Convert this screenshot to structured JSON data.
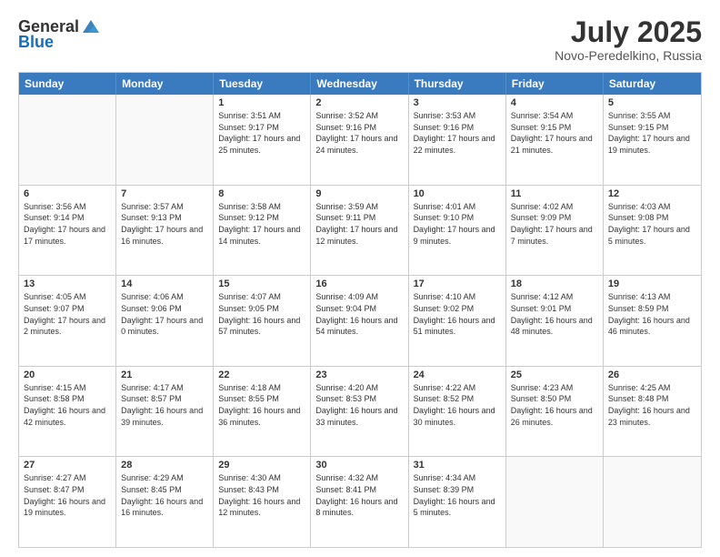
{
  "header": {
    "logo_general": "General",
    "logo_blue": "Blue",
    "month_year": "July 2025",
    "location": "Novo-Peredelkino, Russia"
  },
  "days_of_week": [
    "Sunday",
    "Monday",
    "Tuesday",
    "Wednesday",
    "Thursday",
    "Friday",
    "Saturday"
  ],
  "weeks": [
    [
      {
        "day": "",
        "info": ""
      },
      {
        "day": "",
        "info": ""
      },
      {
        "day": "1",
        "info": "Sunrise: 3:51 AM\nSunset: 9:17 PM\nDaylight: 17 hours and 25 minutes."
      },
      {
        "day": "2",
        "info": "Sunrise: 3:52 AM\nSunset: 9:16 PM\nDaylight: 17 hours and 24 minutes."
      },
      {
        "day": "3",
        "info": "Sunrise: 3:53 AM\nSunset: 9:16 PM\nDaylight: 17 hours and 22 minutes."
      },
      {
        "day": "4",
        "info": "Sunrise: 3:54 AM\nSunset: 9:15 PM\nDaylight: 17 hours and 21 minutes."
      },
      {
        "day": "5",
        "info": "Sunrise: 3:55 AM\nSunset: 9:15 PM\nDaylight: 17 hours and 19 minutes."
      }
    ],
    [
      {
        "day": "6",
        "info": "Sunrise: 3:56 AM\nSunset: 9:14 PM\nDaylight: 17 hours and 17 minutes."
      },
      {
        "day": "7",
        "info": "Sunrise: 3:57 AM\nSunset: 9:13 PM\nDaylight: 17 hours and 16 minutes."
      },
      {
        "day": "8",
        "info": "Sunrise: 3:58 AM\nSunset: 9:12 PM\nDaylight: 17 hours and 14 minutes."
      },
      {
        "day": "9",
        "info": "Sunrise: 3:59 AM\nSunset: 9:11 PM\nDaylight: 17 hours and 12 minutes."
      },
      {
        "day": "10",
        "info": "Sunrise: 4:01 AM\nSunset: 9:10 PM\nDaylight: 17 hours and 9 minutes."
      },
      {
        "day": "11",
        "info": "Sunrise: 4:02 AM\nSunset: 9:09 PM\nDaylight: 17 hours and 7 minutes."
      },
      {
        "day": "12",
        "info": "Sunrise: 4:03 AM\nSunset: 9:08 PM\nDaylight: 17 hours and 5 minutes."
      }
    ],
    [
      {
        "day": "13",
        "info": "Sunrise: 4:05 AM\nSunset: 9:07 PM\nDaylight: 17 hours and 2 minutes."
      },
      {
        "day": "14",
        "info": "Sunrise: 4:06 AM\nSunset: 9:06 PM\nDaylight: 17 hours and 0 minutes."
      },
      {
        "day": "15",
        "info": "Sunrise: 4:07 AM\nSunset: 9:05 PM\nDaylight: 16 hours and 57 minutes."
      },
      {
        "day": "16",
        "info": "Sunrise: 4:09 AM\nSunset: 9:04 PM\nDaylight: 16 hours and 54 minutes."
      },
      {
        "day": "17",
        "info": "Sunrise: 4:10 AM\nSunset: 9:02 PM\nDaylight: 16 hours and 51 minutes."
      },
      {
        "day": "18",
        "info": "Sunrise: 4:12 AM\nSunset: 9:01 PM\nDaylight: 16 hours and 48 minutes."
      },
      {
        "day": "19",
        "info": "Sunrise: 4:13 AM\nSunset: 8:59 PM\nDaylight: 16 hours and 46 minutes."
      }
    ],
    [
      {
        "day": "20",
        "info": "Sunrise: 4:15 AM\nSunset: 8:58 PM\nDaylight: 16 hours and 42 minutes."
      },
      {
        "day": "21",
        "info": "Sunrise: 4:17 AM\nSunset: 8:57 PM\nDaylight: 16 hours and 39 minutes."
      },
      {
        "day": "22",
        "info": "Sunrise: 4:18 AM\nSunset: 8:55 PM\nDaylight: 16 hours and 36 minutes."
      },
      {
        "day": "23",
        "info": "Sunrise: 4:20 AM\nSunset: 8:53 PM\nDaylight: 16 hours and 33 minutes."
      },
      {
        "day": "24",
        "info": "Sunrise: 4:22 AM\nSunset: 8:52 PM\nDaylight: 16 hours and 30 minutes."
      },
      {
        "day": "25",
        "info": "Sunrise: 4:23 AM\nSunset: 8:50 PM\nDaylight: 16 hours and 26 minutes."
      },
      {
        "day": "26",
        "info": "Sunrise: 4:25 AM\nSunset: 8:48 PM\nDaylight: 16 hours and 23 minutes."
      }
    ],
    [
      {
        "day": "27",
        "info": "Sunrise: 4:27 AM\nSunset: 8:47 PM\nDaylight: 16 hours and 19 minutes."
      },
      {
        "day": "28",
        "info": "Sunrise: 4:29 AM\nSunset: 8:45 PM\nDaylight: 16 hours and 16 minutes."
      },
      {
        "day": "29",
        "info": "Sunrise: 4:30 AM\nSunset: 8:43 PM\nDaylight: 16 hours and 12 minutes."
      },
      {
        "day": "30",
        "info": "Sunrise: 4:32 AM\nSunset: 8:41 PM\nDaylight: 16 hours and 8 minutes."
      },
      {
        "day": "31",
        "info": "Sunrise: 4:34 AM\nSunset: 8:39 PM\nDaylight: 16 hours and 5 minutes."
      },
      {
        "day": "",
        "info": ""
      },
      {
        "day": "",
        "info": ""
      }
    ]
  ]
}
